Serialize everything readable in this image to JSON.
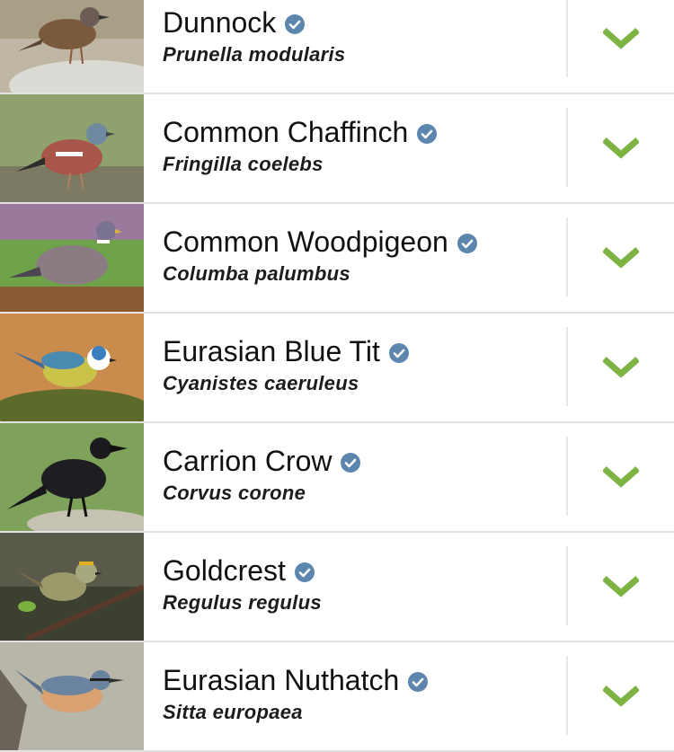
{
  "colors": {
    "verified": "#5c86ae",
    "check": "#7cb342",
    "divider": "#e2e2e2"
  },
  "birds": [
    {
      "name": "Dunnock",
      "scientific": "Prunella modularis",
      "verified_icon": "verified-check-icon",
      "action_icon": "chevron-down-icon"
    },
    {
      "name": "Common Chaffinch",
      "scientific": "Fringilla coelebs",
      "verified_icon": "verified-check-icon",
      "action_icon": "chevron-down-icon"
    },
    {
      "name": "Common Woodpigeon",
      "scientific": "Columba palumbus",
      "verified_icon": "verified-check-icon",
      "action_icon": "chevron-down-icon"
    },
    {
      "name": "Eurasian Blue Tit",
      "scientific": "Cyanistes caeruleus",
      "verified_icon": "verified-check-icon",
      "action_icon": "chevron-down-icon"
    },
    {
      "name": "Carrion Crow",
      "scientific": "Corvus corone",
      "verified_icon": "verified-check-icon",
      "action_icon": "chevron-down-icon"
    },
    {
      "name": "Goldcrest",
      "scientific": "Regulus regulus",
      "verified_icon": "verified-check-icon",
      "action_icon": "chevron-down-icon"
    },
    {
      "name": "Eurasian Nuthatch",
      "scientific": "Sitta europaea",
      "verified_icon": "verified-check-icon",
      "action_icon": "chevron-down-icon"
    }
  ]
}
